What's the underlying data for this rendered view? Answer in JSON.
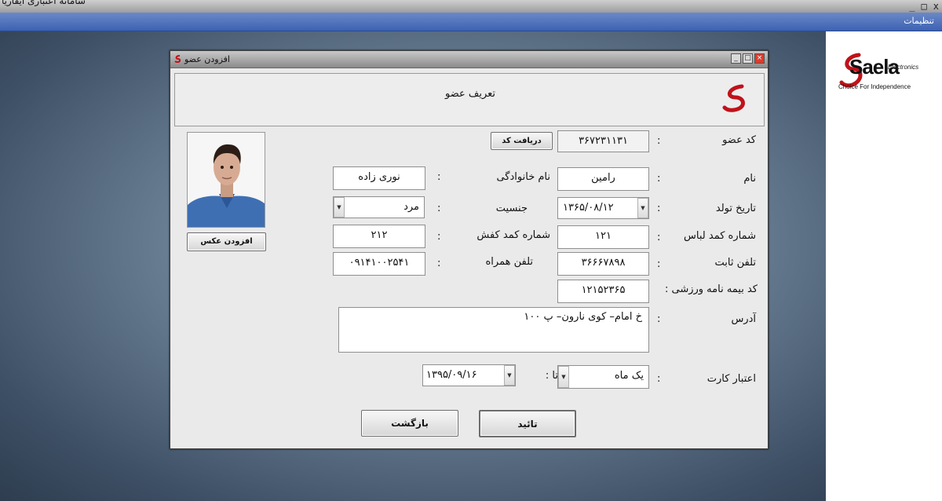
{
  "app": {
    "title": "سامانه اعتباری ایفاریا",
    "menu": "تنظیمات"
  },
  "brand": {
    "name": "Saela",
    "sub": "Electronics",
    "tagline": "Choice For Independence"
  },
  "dialog": {
    "title": "افزودن عضو",
    "header": "تعریف عضو",
    "member_code_label": "کد عضو",
    "member_code": "۳۶۷۲۳۱۱۳۱",
    "get_code_button": "دریافت کد",
    "first_name_label": "نام",
    "first_name": "رامین",
    "last_name_label": "نام خانوادگی",
    "last_name": "نوری زاده",
    "birth_date_label": "تاریخ تولد",
    "birth_date": "۱۳۶۵/۰۸/۱۲",
    "gender_label": "جنسیت",
    "gender": "مرد",
    "cloth_size_label": "شماره کمد لباس",
    "cloth_size": "۱۲۱",
    "shoe_size_label": "شماره کمد کفش",
    "shoe_size": "۲۱۲",
    "phone_label": "تلفن ثابت",
    "phone": "۳۶۶۶۷۸۹۸",
    "mobile_label": "تلفن همراه",
    "mobile": "۰۹۱۴۱۰۰۲۵۴۱",
    "insurance_label": "کد بیمه نامه ورزشی :",
    "insurance": "۱۲۱۵۲۳۶۵",
    "address_label": "آدرس",
    "address": "خ امام– کوی نارون– پ ۱۰۰",
    "card_validity_label": "اعتبار کارت",
    "card_validity": "یک ماه",
    "until_label": "تا :",
    "until_date": "۱۳۹۵/۰۹/۱۶",
    "add_photo_button": "افزودن عکس",
    "confirm_button": "تائید",
    "back_button": "بازگشت",
    "colon": ":"
  },
  "colors": {
    "menubar": "#3d62b2",
    "brand_red": "#c0121a"
  }
}
